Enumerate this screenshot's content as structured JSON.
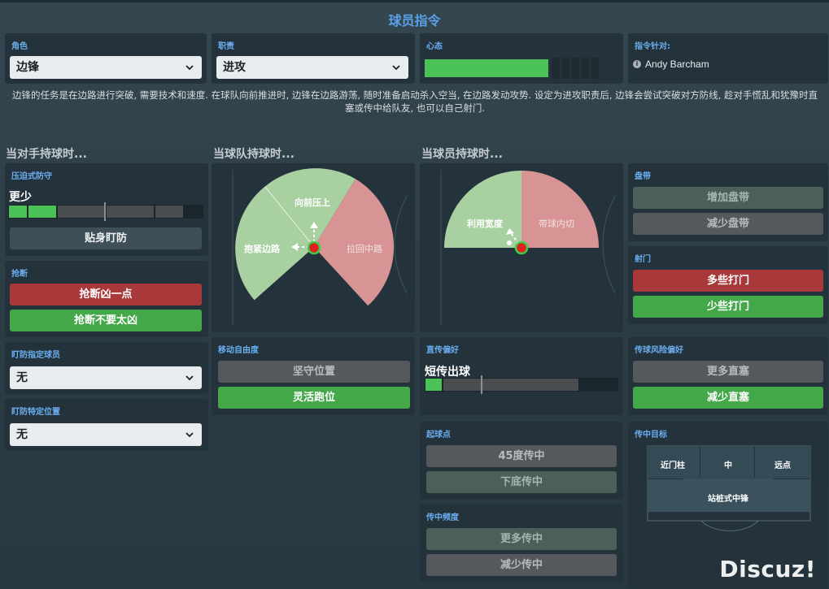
{
  "title": "球员指令",
  "role": {
    "label": "角色",
    "value": "边锋"
  },
  "duty": {
    "label": "职责",
    "value": "进攻"
  },
  "mentality": {
    "label": "心态",
    "level_fraction": 0.72
  },
  "instructions_for": {
    "label": "指令针对:",
    "player": "Andy Barcham"
  },
  "description": "边锋的任务是在边路进行突破, 需要技术和速度. 在球队向前推进时, 边锋在边路游荡, 随时准备启动杀入空当, 在边路发动攻势. 设定为进攻职责后, 边锋会尝试突破对方防线, 趁对手慌乱和犹豫时直塞或传中给队友, 也可以自己射门.",
  "sections": {
    "opp_ball": "当对手持球时...",
    "team_ball": "当球队持球时...",
    "player_ball": "当球员持球时..."
  },
  "pressing": {
    "label": "压迫式防守",
    "value_text": "更少",
    "level_segments": 2,
    "button": "贴身盯防"
  },
  "tackling": {
    "label": "抢断",
    "btn_hard": "抢断凶一点",
    "btn_easy": "抢断不要太凶"
  },
  "mark_player": {
    "label": "盯防指定球员",
    "value": "无"
  },
  "mark_position": {
    "label": "盯防特定位置",
    "value": "无"
  },
  "team_pitch": {
    "forward": "向前压上",
    "hug_line": "抱紧边路",
    "cut_inside": "拉回中路"
  },
  "player_pitch": {
    "width": "利用宽度",
    "dribble_inside": "带球内切"
  },
  "freedom": {
    "label": "移动自由度",
    "hold": "坚守位置",
    "roam": "灵活跑位"
  },
  "passing": {
    "label": "直传偏好",
    "value_text": "短传出球"
  },
  "dribbling": {
    "label": "盘带",
    "more": "增加盘带",
    "less": "减少盘带"
  },
  "shooting": {
    "label": "射门",
    "more": "多些打门",
    "less": "少些打门"
  },
  "risky_passes": {
    "label": "传球风险偏好",
    "more": "更多直塞",
    "less": "减少直塞"
  },
  "cross_from": {
    "label": "起球点",
    "deep": "45度传中",
    "byline": "下底传中"
  },
  "cross_freq": {
    "label": "传中频度",
    "more": "更多传中",
    "less": "减少传中"
  },
  "cross_target": {
    "label": "传中目标",
    "near": "近门柱",
    "centre": "中",
    "far": "远点",
    "target_man": "站桩式中锋"
  },
  "watermark": "Discuz!",
  "colors": {
    "accent": "#5aa0e8",
    "green": "#44a84a",
    "red": "#a8383a",
    "pitch_green": "#a8d0a0",
    "pitch_red": "#d89494"
  }
}
